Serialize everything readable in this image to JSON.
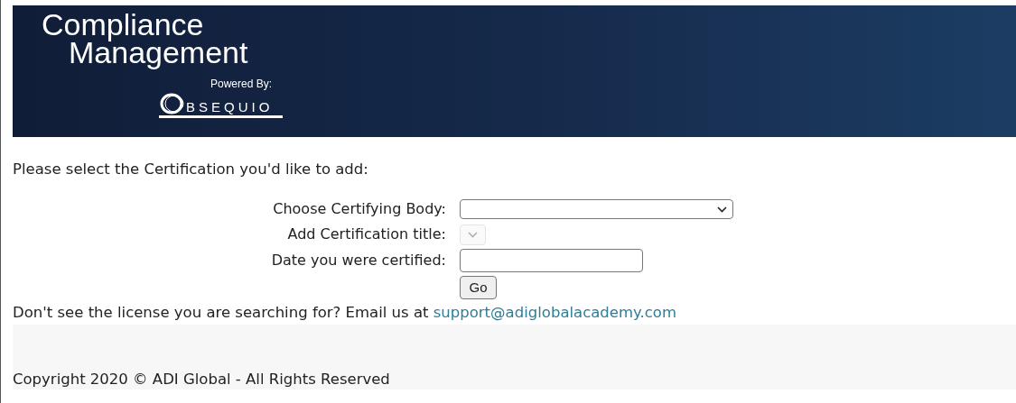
{
  "banner": {
    "title_line_1": "Compliance",
    "title_line_2": "Management",
    "powered_by": "Powered By:",
    "logo": "BSEQUIO"
  },
  "heading": "Please select the Certification you'd like to add:",
  "form": {
    "fields": [
      {
        "kind": "select",
        "label": "Choose Certifying Body:",
        "disabled": false
      },
      {
        "kind": "select",
        "label": "Add Certification title:",
        "disabled": true
      },
      {
        "kind": "input",
        "label": "Date you were certified:",
        "disabled": false
      }
    ],
    "submit": "Go"
  },
  "help": {
    "text": "Don't see the license you are searching for? Email us at",
    "link": "support@adiglobalacademy.com"
  },
  "footer": {
    "copyright": "Copyright 2020 © ADI Global - All Rights Reserved"
  }
}
